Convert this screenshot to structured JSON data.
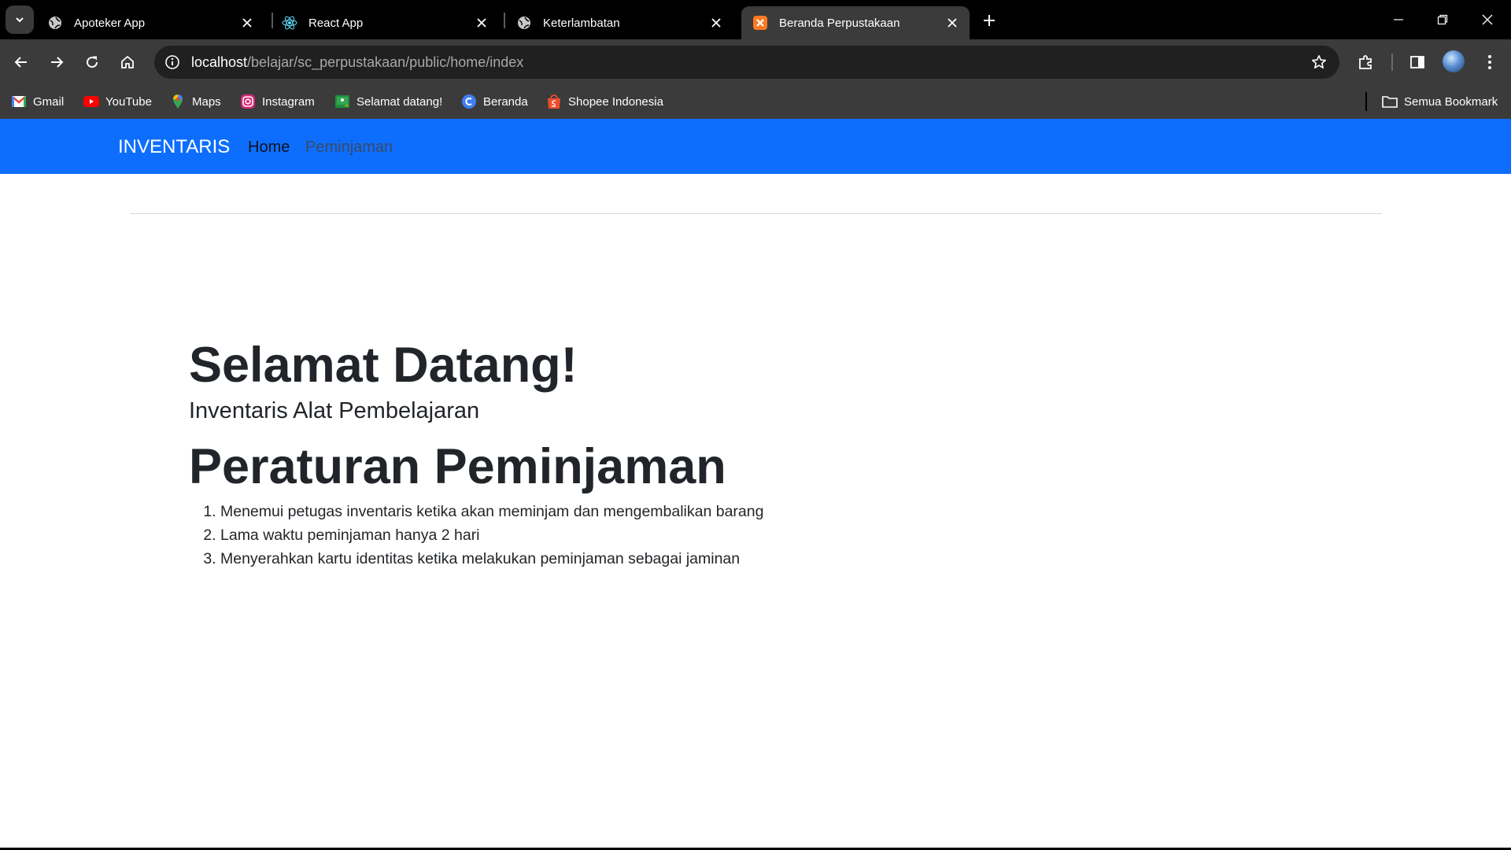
{
  "browser": {
    "tabs": [
      {
        "title": "Apoteker App",
        "icon": "globe-icon",
        "active": false
      },
      {
        "title": "React App",
        "icon": "react-icon",
        "active": false
      },
      {
        "title": "Keterlambatan",
        "icon": "globe-icon",
        "active": false
      },
      {
        "title": "Beranda Perpustakaan",
        "icon": "xampp-icon",
        "active": true
      }
    ],
    "address": {
      "host": "localhost",
      "path": "/belajar/sc_perpustakaan/public/home/index"
    },
    "bookmarks": [
      {
        "label": "Gmail",
        "icon": "gmail-icon"
      },
      {
        "label": "YouTube",
        "icon": "youtube-icon"
      },
      {
        "label": "Maps",
        "icon": "maps-icon"
      },
      {
        "label": "Instagram",
        "icon": "instagram-icon"
      },
      {
        "label": "Selamat datang!",
        "icon": "classroom-icon"
      },
      {
        "label": "Beranda",
        "icon": "canva-icon"
      },
      {
        "label": "Shopee Indonesia",
        "icon": "shopee-icon"
      }
    ],
    "all_bookmarks": "Semua Bookmark"
  },
  "navbar": {
    "brand": "INVENTARIS",
    "links": [
      "Home",
      "Peminjaman"
    ],
    "color": "#0d6efd"
  },
  "main": {
    "title": "Selamat Datang!",
    "subtitle": "Inventaris Alat Pembelajaran",
    "rules_title": "Peraturan Peminjaman",
    "rules": [
      "Menemui petugas inventaris ketika akan meminjam dan mengembalikan barang",
      "Lama waktu peminjaman hanya 2 hari",
      "Menyerahkan kartu identitas ketika melakukan peminjaman sebagai jaminan"
    ]
  }
}
